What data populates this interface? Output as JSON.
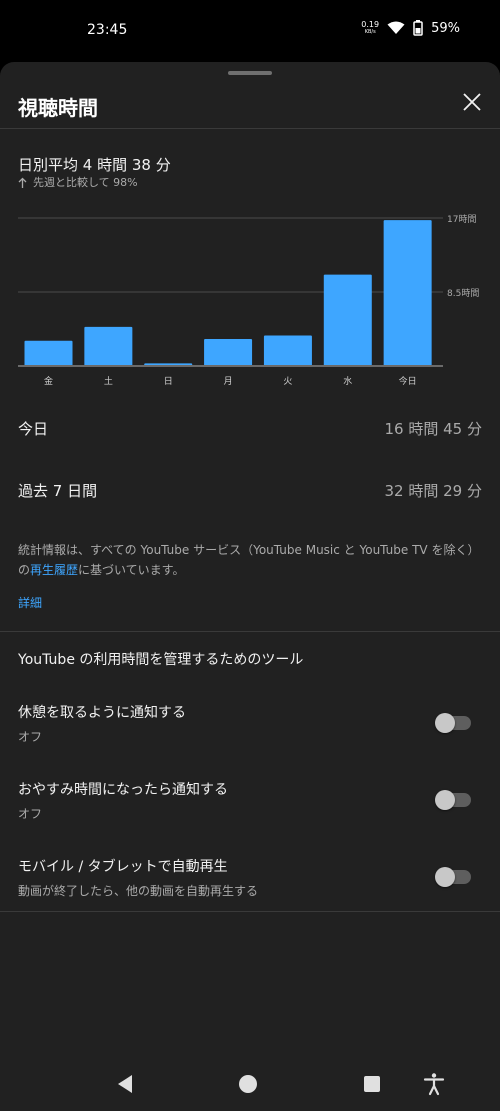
{
  "status_bar": {
    "time": "23:45",
    "net_speed": "0.19",
    "net_unit": "KB/s",
    "battery": "59%"
  },
  "sheet": {
    "title": "視聴時間",
    "close_icon": "close-icon"
  },
  "summary": {
    "daily_average": "日別平均 4 時間 38 分",
    "comparison": "先週と比較して 98%",
    "comparison_icon": "arrow-up-icon"
  },
  "chart_data": {
    "type": "bar",
    "categories": [
      "金",
      "土",
      "日",
      "月",
      "火",
      "水",
      "今日"
    ],
    "values": [
      2.9,
      4.5,
      0.3,
      3.1,
      3.5,
      10.5,
      16.75
    ],
    "ylim": [
      0,
      17
    ],
    "yticks": [
      "8.5時間",
      "17時間"
    ],
    "ytick_values": [
      8.5,
      17
    ],
    "bar_color": "#3ea6ff"
  },
  "stats": [
    {
      "label": "今日",
      "value": "16 時間 45 分"
    },
    {
      "label": "過去 7 日間",
      "value": "32 時間 29 分"
    }
  ],
  "info": {
    "text_before": "統計情報は、すべての YouTube サービス（YouTube Music と YouTube TV を除く）の",
    "link": "再生履歴",
    "text_after": "に基づいています。",
    "more": "詳細"
  },
  "tools": {
    "title": "YouTube の利用時間を管理するためのツール",
    "settings": [
      {
        "title": "休憩を取るように通知する",
        "subtitle": "オフ",
        "enabled": false
      },
      {
        "title": "おやすみ時間になったら通知する",
        "subtitle": "オフ",
        "enabled": false
      },
      {
        "title": "モバイル / タブレットで自動再生",
        "subtitle": "動画が終了したら、他の動画を自動再生する",
        "enabled": false
      }
    ]
  },
  "nav_bar": {
    "icons": [
      "back-icon",
      "home-icon",
      "recents-icon",
      "accessibility-icon"
    ]
  }
}
